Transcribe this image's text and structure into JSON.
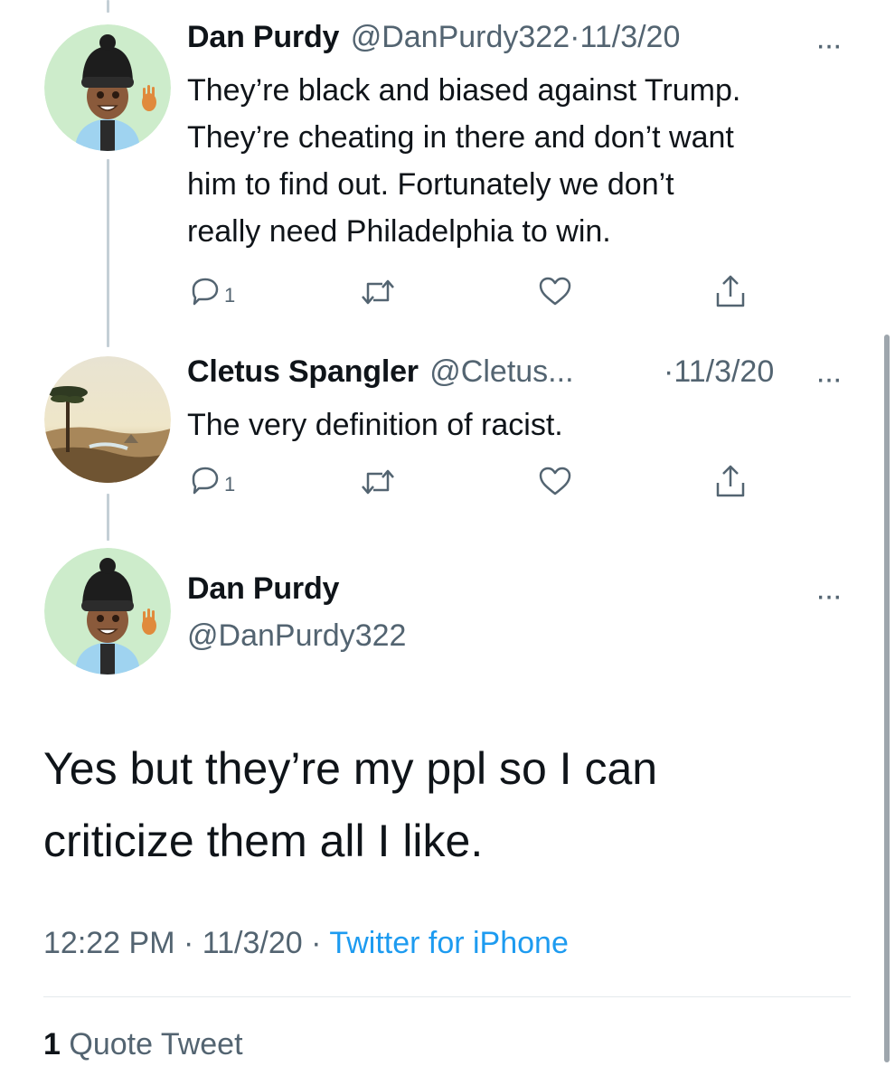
{
  "tweets": [
    {
      "name": "Dan Purdy",
      "handle": "@DanPurdy322",
      "sep": "·",
      "date": "11/3/20",
      "more": "···",
      "lines": [
        "They’re black and biased against Trump.",
        "They’re cheating in there and don’t want",
        "him to find out. Fortunately we don’t",
        "really need Philadelphia to win."
      ],
      "reply_count": "1"
    },
    {
      "name": "Cletus Spangler",
      "handle": "@Cletus...",
      "sep": "·",
      "date": "11/3/20",
      "more": "···",
      "lines": [
        "The very definition of racist."
      ],
      "reply_count": "1"
    }
  ],
  "main": {
    "name": "Dan Purdy",
    "handle": "@DanPurdy322",
    "more": "···",
    "text_lines": [
      "Yes but they’re my ppl so I can",
      "criticize them all I like."
    ],
    "time": "12:22 PM",
    "sep1": "·",
    "date": "11/3/20",
    "sep2": "·",
    "source": "Twitter for iPhone",
    "quote_count": "1",
    "quote_label": "Quote Tweet"
  },
  "colors": {
    "accent": "#1d9bf0",
    "text": "#0f1419",
    "secondary": "#536471",
    "avatar_bg": "#cdeccb"
  },
  "icons": [
    "reply-icon",
    "retweet-icon",
    "like-icon",
    "share-icon"
  ]
}
